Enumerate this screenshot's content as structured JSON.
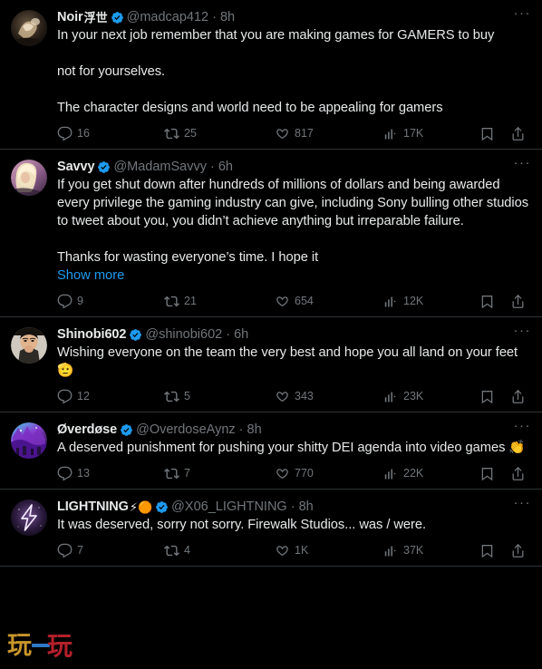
{
  "app": {
    "platform_name": "X",
    "theme": "dark",
    "colors": {
      "background": "#000000",
      "text": "#e7e9ea",
      "muted": "#71767b",
      "accent": "#1d9bf0",
      "divider": "#2f3336"
    }
  },
  "watermark": {
    "text": "玩一玩",
    "left_glyph": "玩",
    "right_glyph": "玩",
    "middle_glyph": "一"
  },
  "icons": {
    "verified": "verified-badge-icon",
    "more": "more-options-icon",
    "reply": "reply-icon",
    "retweet": "retweet-icon",
    "like": "like-heart-icon",
    "views": "views-bar-chart-icon",
    "bookmark": "bookmark-icon",
    "share": "share-icon",
    "more_glyph": "···",
    "separator_dot": "·"
  },
  "tweets": [
    {
      "id": "tweet-noir",
      "display_name": "Noir",
      "display_name_suffix": "浮世",
      "verified": true,
      "handle": "@madcap412",
      "time": "8h",
      "avatar_name": "avatar-noir",
      "text": "In your next job remember that you are making games for GAMERS to buy\n\nnot for yourselves.\n\nThe character designs and world need to be appealing for gamers",
      "show_more": false,
      "show_more_label": "Show more",
      "metrics": {
        "replies": "16",
        "retweets": "25",
        "likes": "817",
        "views": "17K"
      }
    },
    {
      "id": "tweet-savvy",
      "display_name": "Savvy",
      "display_name_suffix": "",
      "verified": true,
      "handle": "@MadamSavvy",
      "time": "6h",
      "avatar_name": "avatar-savvy",
      "text": "If you get shut down after hundreds of millions of dollars and being awarded every privilege the gaming industry can give, including Sony bulling other studios to tweet about you, you didn’t achieve anything but irreparable failure.\n\nThanks for wasting everyone’s time. I hope it",
      "show_more": true,
      "show_more_label": "Show more",
      "metrics": {
        "replies": "9",
        "retweets": "21",
        "likes": "654",
        "views": "12K"
      }
    },
    {
      "id": "tweet-shinobi602",
      "display_name": "Shinobi602",
      "display_name_suffix": "",
      "verified": true,
      "handle": "@shinobi602",
      "time": "6h",
      "avatar_name": "avatar-shinobi602",
      "text": "Wishing everyone on the team the very best and hope you all land on your feet 🫡",
      "show_more": false,
      "show_more_label": "Show more",
      "metrics": {
        "replies": "12",
        "retweets": "5",
        "likes": "343",
        "views": "23K"
      }
    },
    {
      "id": "tweet-overdose",
      "display_name": "Øverdøse",
      "display_name_suffix": "",
      "verified": true,
      "handle": "@OverdoseAynz",
      "time": "8h",
      "avatar_name": "avatar-overdose",
      "text": "A deserved punishment for pushing your shitty DEI agenda into video games 👏",
      "show_more": false,
      "show_more_label": "Show more",
      "metrics": {
        "replies": "13",
        "retweets": "7",
        "likes": "770",
        "views": "22K"
      }
    },
    {
      "id": "tweet-lightning",
      "display_name": "LIGHTNING",
      "display_name_suffix": "⚡🟠",
      "verified": true,
      "handle": "@X06_LIGHTNING",
      "time": "8h",
      "avatar_name": "avatar-lightning",
      "text": "It was deserved, sorry not sorry. Firewalk Studios... was / were.",
      "show_more": false,
      "show_more_label": "Show more",
      "metrics": {
        "replies": "7",
        "retweets": "4",
        "likes": "1K",
        "views": "37K"
      }
    }
  ]
}
